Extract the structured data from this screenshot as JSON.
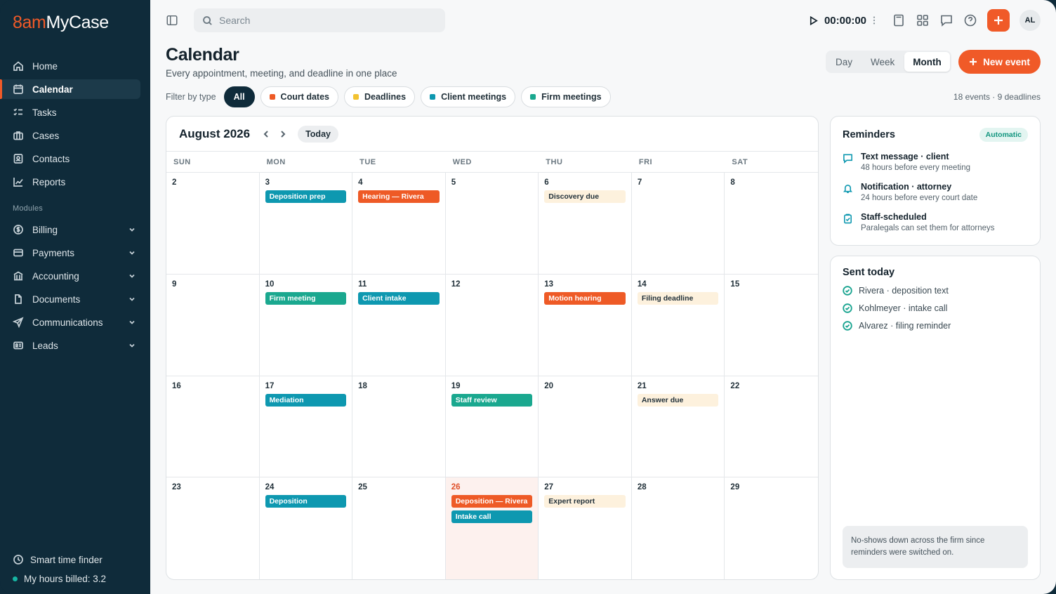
{
  "app": {
    "logo_prefix": "8am",
    "logo_suffix": "MyCase"
  },
  "sidebar": {
    "items": [
      {
        "label": "Home",
        "icon": "home-icon"
      },
      {
        "label": "Calendar",
        "icon": "calendar-icon",
        "active": true
      },
      {
        "label": "Tasks",
        "icon": "tasks-icon"
      },
      {
        "label": "Cases",
        "icon": "briefcase-icon"
      },
      {
        "label": "Contacts",
        "icon": "contacts-icon"
      },
      {
        "label": "Reports",
        "icon": "chart-icon"
      }
    ],
    "modules_label": "Modules",
    "modules": [
      {
        "label": "Billing",
        "icon": "dollar-icon"
      },
      {
        "label": "Payments",
        "icon": "card-icon"
      },
      {
        "label": "Accounting",
        "icon": "bank-icon"
      },
      {
        "label": "Documents",
        "icon": "document-icon"
      },
      {
        "label": "Communications",
        "icon": "send-icon"
      },
      {
        "label": "Leads",
        "icon": "id-card-icon"
      }
    ],
    "footer": {
      "smart_time": "Smart time finder",
      "hours": "My hours billed: 3.2"
    }
  },
  "topbar": {
    "search_placeholder": "Search",
    "timer": "00:00:00",
    "avatar": "AL"
  },
  "page": {
    "title": "Calendar",
    "subtitle": "Every appointment, meeting, and deadline in one place",
    "views": [
      "Day",
      "Week",
      "Month"
    ],
    "active_view": "Month",
    "new_event": "New event",
    "filter_label": "Filter by type",
    "filters": [
      {
        "label": "All"
      },
      {
        "label": "Court dates",
        "color": "#ee5a26"
      },
      {
        "label": "Deadlines",
        "color": "#f2c230"
      },
      {
        "label": "Client meetings",
        "color": "#0e98b0"
      },
      {
        "label": "Firm meetings",
        "color": "#1aa88f"
      }
    ],
    "meta": "18 events · 9 deadlines"
  },
  "calendar": {
    "month": "August 2026",
    "today_label": "Today",
    "weekdays": [
      "SUN",
      "MON",
      "TUE",
      "WED",
      "THU",
      "FRI",
      "SAT"
    ],
    "weeks": [
      [
        {
          "d": "2",
          "ev": []
        },
        {
          "d": "3",
          "ev": [
            {
              "t": "Deposition prep",
              "k": "client"
            }
          ]
        },
        {
          "d": "4",
          "ev": [
            {
              "t": "Hearing — Rivera",
              "k": "court"
            }
          ]
        },
        {
          "d": "5",
          "ev": []
        },
        {
          "d": "6",
          "ev": [
            {
              "t": "Discovery due",
              "k": "dead"
            }
          ]
        },
        {
          "d": "7",
          "ev": []
        },
        {
          "d": "8",
          "ev": []
        }
      ],
      [
        {
          "d": "9",
          "ev": []
        },
        {
          "d": "10",
          "ev": [
            {
              "t": "Firm meeting",
              "k": "firm"
            }
          ]
        },
        {
          "d": "11",
          "ev": [
            {
              "t": "Client intake",
              "k": "client"
            }
          ]
        },
        {
          "d": "12",
          "ev": []
        },
        {
          "d": "13",
          "ev": [
            {
              "t": "Motion hearing",
              "k": "court"
            }
          ]
        },
        {
          "d": "14",
          "ev": [
            {
              "t": "Filing deadline",
              "k": "dead"
            }
          ]
        },
        {
          "d": "15",
          "ev": []
        }
      ],
      [
        {
          "d": "16",
          "ev": []
        },
        {
          "d": "17",
          "ev": [
            {
              "t": "Mediation",
              "k": "client"
            }
          ]
        },
        {
          "d": "18",
          "ev": []
        },
        {
          "d": "19",
          "ev": [
            {
              "t": "Staff review",
              "k": "firm"
            }
          ]
        },
        {
          "d": "20",
          "ev": []
        },
        {
          "d": "21",
          "ev": [
            {
              "t": "Answer due",
              "k": "dead"
            }
          ]
        },
        {
          "d": "22",
          "ev": []
        }
      ],
      [
        {
          "d": "23",
          "ev": []
        },
        {
          "d": "24",
          "ev": [
            {
              "t": "Deposition",
              "k": "client"
            }
          ]
        },
        {
          "d": "25",
          "ev": []
        },
        {
          "d": "26",
          "today": true,
          "ev": [
            {
              "t": "Deposition — Rivera",
              "k": "court"
            },
            {
              "t": "Intake call",
              "k": "client"
            }
          ]
        },
        {
          "d": "27",
          "ev": [
            {
              "t": "Expert report",
              "k": "dead"
            }
          ]
        },
        {
          "d": "28",
          "ev": []
        },
        {
          "d": "29",
          "ev": []
        }
      ]
    ]
  },
  "reminders": {
    "title": "Reminders",
    "badge": "Automatic",
    "items": [
      {
        "title": "Text message · client",
        "desc": "48 hours before every meeting",
        "icon": "message-icon"
      },
      {
        "title": "Notification · attorney",
        "desc": "24 hours before every court date",
        "icon": "bell-icon"
      },
      {
        "title": "Staff-scheduled",
        "desc": "Paralegals can set them for attorneys",
        "icon": "clipboard-icon"
      }
    ]
  },
  "sent": {
    "title": "Sent today",
    "items": [
      "Rivera · deposition text",
      "Kohlmeyer · intake call",
      "Alvarez · filing reminder"
    ],
    "note": "No-shows down across the firm since reminders were switched on."
  },
  "colors": {
    "brand": "#f05a28",
    "sidebar": "#0f2b3a",
    "court": "#ee5a26",
    "client": "#0e98b0",
    "firm": "#1aa88f",
    "deadline": "#fdf1dd"
  }
}
